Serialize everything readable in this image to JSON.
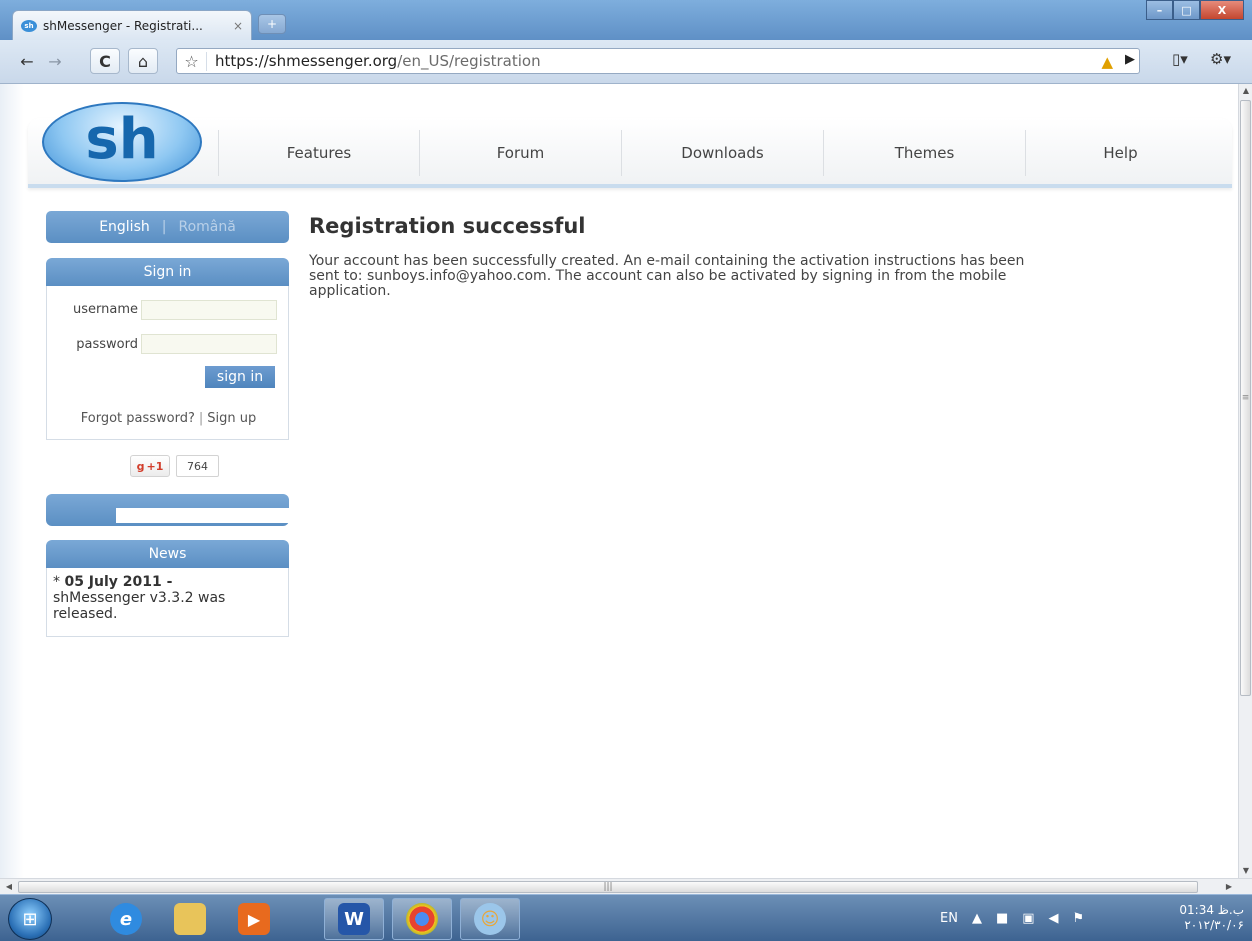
{
  "browser": {
    "tab_title": "shMessenger - Registrati...",
    "tab_close": "×",
    "new_tab": "+",
    "url_domain": "https://shmessenger.org",
    "url_path": "/en_US/registration"
  },
  "window_controls": {
    "minimize": "–",
    "maximize": "□",
    "close": "X"
  },
  "site": {
    "logo_text": "sh",
    "nav": [
      "Features",
      "Forum",
      "Downloads",
      "Themes",
      "Help"
    ]
  },
  "language": {
    "english": "English",
    "separator": "|",
    "romanian": "Română"
  },
  "signin": {
    "heading": "Sign in",
    "username_label": "username",
    "password_label": "password",
    "button": "sign in",
    "forgot": "Forgot password?",
    "separator": "|",
    "signup": "Sign up"
  },
  "gplus": {
    "label": "+1",
    "count": "764"
  },
  "news": {
    "heading": "News",
    "bullet": "* ",
    "date": "05 July 2011 -",
    "text": "shMessenger v3.3.2 was released."
  },
  "main": {
    "title": "Registration successful",
    "message": "Your account has been successfully created. An e-mail containing the activation instructions has been sent to: sunboys.info@yahoo.com. The account can also be activated by signing in from the mobile application."
  },
  "taskbar": {
    "tray_lang": "EN",
    "clock_time": "01:34 ب.ظ",
    "clock_date": "۲۰۱۲/۳۰/۰۶"
  },
  "colors": {
    "accent": "#5b8fc3",
    "brand": "#1667ad",
    "warning": "#e0a000"
  },
  "icons": {
    "back": "back-arrow-icon",
    "forward": "forward-arrow-icon",
    "reload": "reload-icon",
    "home": "home-icon",
    "bookmark": "star-icon",
    "warning": "warning-icon",
    "page": "page-menu-icon",
    "tools": "wrench-icon"
  }
}
